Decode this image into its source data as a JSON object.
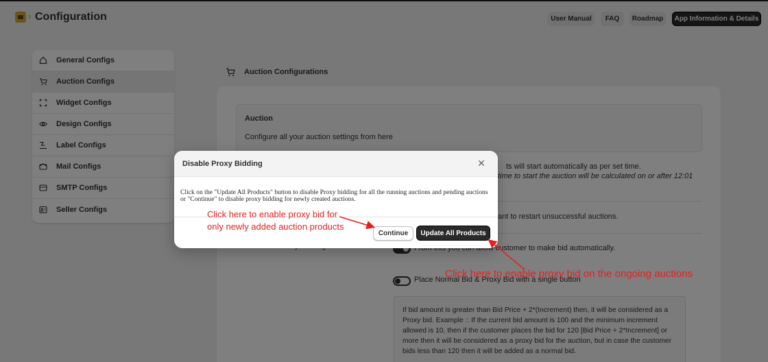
{
  "header": {
    "title": "Configuration",
    "buttons": {
      "user_manual": "User Manual",
      "faq": "FAQ",
      "roadmap": "Roadmap",
      "app_info": "App Information & Details"
    }
  },
  "sidebar": {
    "items": [
      {
        "label": "General Configs",
        "icon": "home-icon"
      },
      {
        "label": "Auction Configs",
        "icon": "auction-cart-icon"
      },
      {
        "label": "Widget Configs",
        "icon": "widget-icon"
      },
      {
        "label": "Design Configs",
        "icon": "eye-icon"
      },
      {
        "label": "Label Configs",
        "icon": "label-icon"
      },
      {
        "label": "Mail Configs",
        "icon": "mail-icon"
      },
      {
        "label": "SMTP Configs",
        "icon": "smtp-icon"
      },
      {
        "label": "Seller Configs",
        "icon": "seller-icon"
      }
    ],
    "active_index": 1
  },
  "main": {
    "section_heading": "Auction Configurations",
    "info_title": "Auction",
    "info_subtitle": "Configure all your auction settings from here",
    "row1_line1": "ts will start automatically as per set time.",
    "row1_line2": "time to start the auction will be calculated on or after 12:01",
    "row2_text": "ant to restart unsuccessful auctions.",
    "proxy_label": "Enable Proxy Bidding",
    "proxy_toggle_text": "From this you can allow customer to make bid automatically.",
    "normal_proxy_toggle_text": "Place Normal Bid & Proxy Bid with a single button",
    "note": "If bid amount is greater than Bid Price + 2*(Increment) then, it will be considered as a Proxy bid. Example :: If the current bid amount is 100 and the minimum increment allowed is 10, then if the customer places the bid for 120 [Bid Price + 2*Increment] or more then it will be considered as a proxy bid for the auction, but in case the customer bids less than 120 then it will be added as a normal bid."
  },
  "modal": {
    "title": "Disable Proxy Bidding",
    "body": "Click on the \"Update All Products\" button to disable Proxy bidding for all the running auctions and pending auctions or \"Continue\" to disable proxy bidding for newly created auctions.",
    "continue_label": "Continue",
    "update_label": "Update All Products"
  },
  "annotations": {
    "continue_hint_line1": "Click here to enable proxy bid for",
    "continue_hint_line2": "only newly added auction products",
    "update_hint": "Click here to enable proxy bid on the ongoing auctions",
    "color": "#e52020"
  },
  "colors": {
    "accent_dark": "#2a2a2a",
    "overlay": "rgba(0,0,0,0.5)",
    "page_bg": "#f1f1f1"
  }
}
